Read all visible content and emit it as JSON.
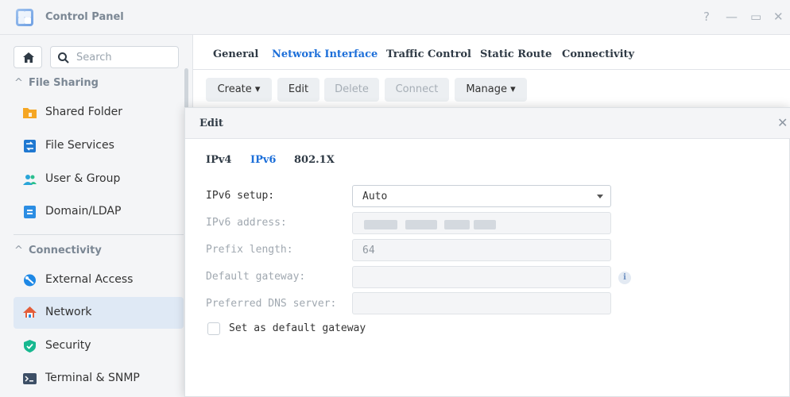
{
  "window": {
    "title": "Control Panel",
    "controls": {
      "help": "?",
      "minimize": "—",
      "maximize": "▭",
      "close": "✕"
    }
  },
  "sidebar": {
    "search_placeholder": "Search",
    "section_file_sharing": "File Sharing",
    "section_connectivity": "Connectivity",
    "items": [
      {
        "label": "Shared Folder",
        "icon": "shared-folder-icon",
        "color": "#f5a623"
      },
      {
        "label": "File Services",
        "icon": "file-services-icon",
        "color": "#1f78d1"
      },
      {
        "label": "User & Group",
        "icon": "user-group-icon",
        "color": "#2aa5d8"
      },
      {
        "label": "Domain/LDAP",
        "icon": "domain-ldap-icon",
        "color": "#2b8de3"
      },
      {
        "label": "External Access",
        "icon": "external-access-icon",
        "color": "#1e88e5"
      },
      {
        "label": "Network",
        "icon": "network-icon",
        "color": "#e35d3a",
        "active": true
      },
      {
        "label": "Security",
        "icon": "security-shield-icon",
        "color": "#17b890"
      },
      {
        "label": "Terminal & SNMP",
        "icon": "terminal-icon",
        "color": "#3d4f66"
      }
    ]
  },
  "tabs": [
    {
      "label": "General"
    },
    {
      "label": "Network Interface",
      "active": true
    },
    {
      "label": "Traffic Control"
    },
    {
      "label": "Static Route"
    },
    {
      "label": "Connectivity"
    }
  ],
  "toolbar": {
    "create": "Create ▾",
    "edit": "Edit",
    "delete": "Delete",
    "connect": "Connect",
    "manage": "Manage ▾"
  },
  "dialog": {
    "title": "Edit",
    "close": "✕",
    "tabs": [
      {
        "label": "IPv4"
      },
      {
        "label": "IPv6",
        "active": true
      },
      {
        "label": "802.1X"
      }
    ],
    "fields": {
      "setup_label": "IPv6 setup:",
      "setup_value": "Auto",
      "address_label": "IPv6 address:",
      "prefix_label": "Prefix length:",
      "prefix_value": "64",
      "gateway_label": "Default gateway:",
      "dns_label": "Preferred DNS server:"
    },
    "info_glyph": "i",
    "checkbox_label": "Set as default gateway",
    "checkbox_checked": false
  },
  "colors": {
    "accent": "#1d6fd9",
    "sidebar_bg": "#f4f5f7",
    "active_item_bg": "#dfe9f5"
  }
}
